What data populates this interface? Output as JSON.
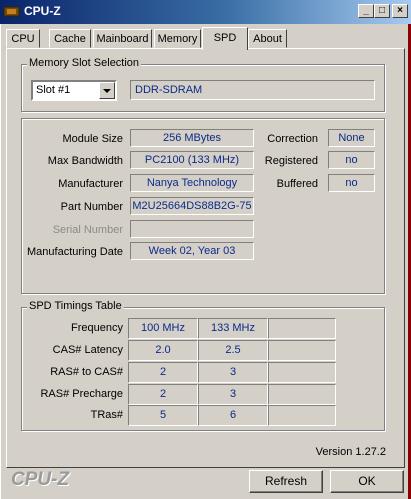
{
  "window": {
    "title": "CPU-Z"
  },
  "tabs": [
    {
      "label": "CPU"
    },
    {
      "label": "Cache"
    },
    {
      "label": "Mainboard"
    },
    {
      "label": "Memory"
    },
    {
      "label": "SPD"
    },
    {
      "label": "About"
    }
  ],
  "active_tab": "SPD",
  "slot_selection": {
    "group_label": "Memory Slot Selection",
    "selected_slot": "Slot #1",
    "memory_type": "DDR-SDRAM"
  },
  "module": {
    "module_size_label": "Module Size",
    "module_size": "256 MBytes",
    "max_bandwidth_label": "Max Bandwidth",
    "max_bandwidth": "PC2100 (133 MHz)",
    "manufacturer_label": "Manufacturer",
    "manufacturer": "Nanya Technology",
    "part_number_label": "Part Number",
    "part_number": "M2U25664DS88B2G-75",
    "serial_number_label": "Serial Number",
    "serial_number": "",
    "manufacturing_date_label": "Manufacturing Date",
    "manufacturing_date": "Week 02, Year 03",
    "correction_label": "Correction",
    "correction": "None",
    "registered_label": "Registered",
    "registered": "no",
    "buffered_label": "Buffered",
    "buffered": "no"
  },
  "timings": {
    "group_label": "SPD Timings Table",
    "rows": [
      {
        "label": "Frequency",
        "col1": "100 MHz",
        "col2": "133 MHz",
        "col3": ""
      },
      {
        "label": "CAS# Latency",
        "col1": "2.0",
        "col2": "2.5",
        "col3": ""
      },
      {
        "label": "RAS# to CAS#",
        "col1": "2",
        "col2": "3",
        "col3": ""
      },
      {
        "label": "RAS# Precharge",
        "col1": "2",
        "col2": "3",
        "col3": ""
      },
      {
        "label": "TRas#",
        "col1": "5",
        "col2": "6",
        "col3": ""
      }
    ]
  },
  "footer": {
    "version": "Version 1.27.2",
    "logo": "CPU-Z",
    "refresh_label": "Refresh",
    "ok_label": "OK"
  },
  "icons": {
    "app": "cpu-chip-icon",
    "minimize": "minimize-icon",
    "maximize": "maximize-icon",
    "close": "close-icon",
    "dropdown": "chevron-down-icon"
  },
  "colors": {
    "value_text": "#0a2a8a",
    "title_bar": "#0a246a",
    "face": "#d4d0c8"
  }
}
